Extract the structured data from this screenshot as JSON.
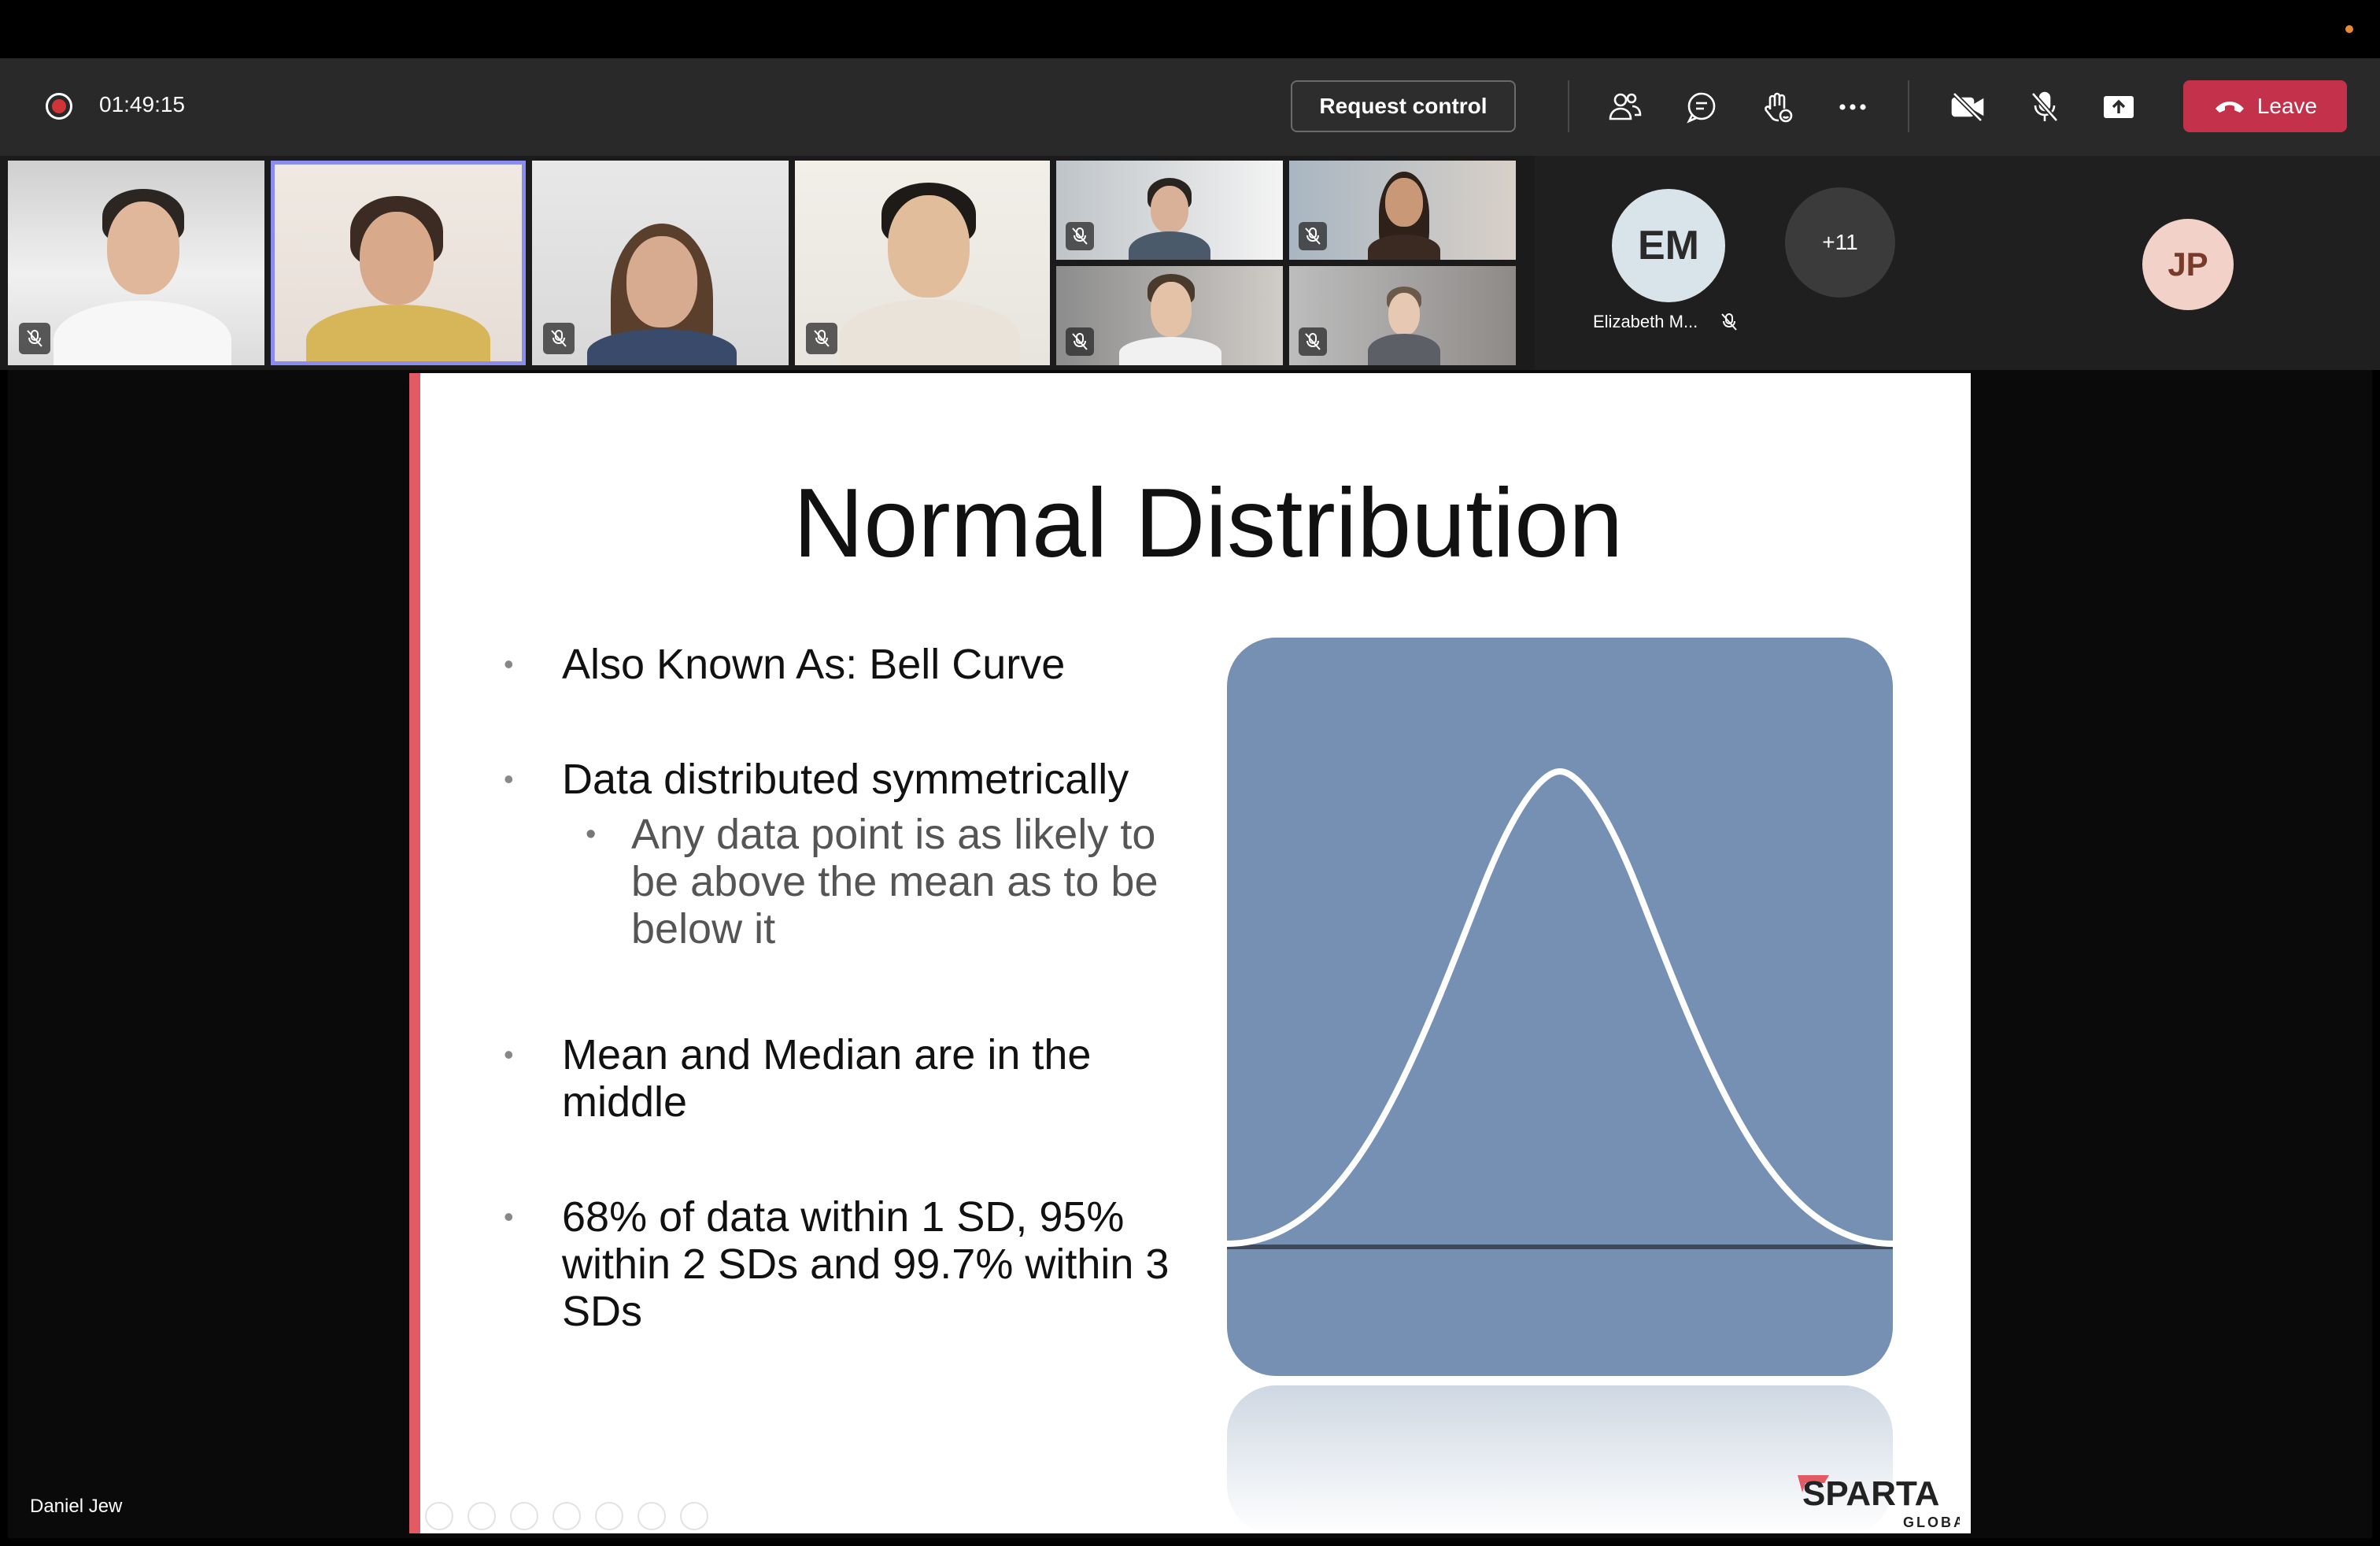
{
  "meeting": {
    "recording_icon": "recording-dot-icon",
    "elapsed_time": "01:49:15",
    "request_control_label": "Request control",
    "leave_label": "Leave",
    "toolbar_icons": [
      "people-icon",
      "chat-icon",
      "raise-hand-icon",
      "more-icon",
      "camera-off-icon",
      "mic-off-icon",
      "share-screen-icon"
    ],
    "colors": {
      "leave": "#c4314b",
      "toolbar": "#292929",
      "active_tile_border": "#8b8cf0"
    }
  },
  "participants": {
    "avatars": [
      {
        "initials": "EM",
        "name": "Elizabeth M...",
        "muted": true
      },
      {
        "initials": "+11"
      },
      {
        "initials": "JP"
      }
    ]
  },
  "slide": {
    "title": "Normal Distribution",
    "bullets": [
      {
        "text": "Also Known As: Bell Curve"
      },
      {
        "text": "Data distributed symmetrically",
        "sub": "Any data point is as likely to be above the mean as to be below it"
      },
      {
        "text": "Mean and Median are in the middle"
      },
      {
        "text": "68% of data within 1 SD, 95% within 2 SDs and 99.7% within 3 SDs"
      }
    ],
    "logo_text": "SPARTA",
    "logo_subtext": "GLOBAL",
    "colors": {
      "accent_bar": "#e15a64",
      "curve_panel": "#7590b3"
    }
  },
  "presenter_name": "Daniel Jew"
}
